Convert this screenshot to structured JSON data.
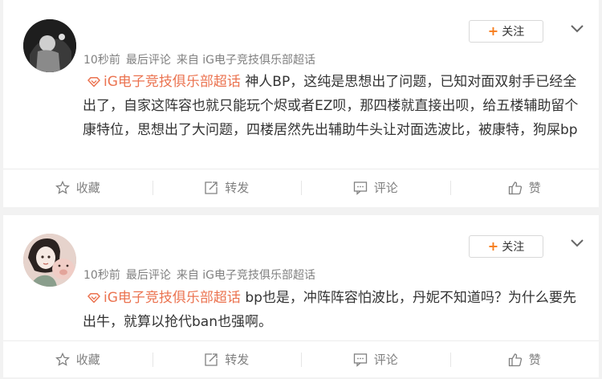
{
  "cards": [
    {
      "meta": {
        "time": "10秒前",
        "tag": "最后评论",
        "source": "来自 iG电子竞技俱乐部超话"
      },
      "follow_label": "关注",
      "topic": "iG电子竞技俱乐部超话",
      "body": "神人BP，这纯是思想出了问题，已知对面双射手已经全出了，自家这阵容也就只能玩个烬或者EZ呗，那四楼就直接出呗，给五楼辅助留个康特位，思想出了大问题，四楼居然先出辅助牛头让对面选波比，被康特，狗屎bp",
      "actions": {
        "fav": "收藏",
        "repost": "转发",
        "comment": "评论",
        "like": "赞"
      }
    },
    {
      "meta": {
        "time": "10秒前",
        "tag": "最后评论",
        "source": "来自 iG电子竞技俱乐部超话"
      },
      "follow_label": "关注",
      "topic": "iG电子竞技俱乐部超话",
      "body": "bp也是，冲阵阵容怕波比，丹妮不知道吗？为什么要先出牛，就算以抢代ban也强啊。",
      "actions": {
        "fav": "收藏",
        "repost": "转发",
        "comment": "评论",
        "like": "赞"
      }
    }
  ],
  "colors": {
    "topic": "#eb7350",
    "follow_plus": "#f77c1b",
    "meta": "#808080"
  },
  "icons": [
    "diamond-icon",
    "star-icon",
    "repost-icon",
    "comment-icon",
    "thumbs-up-icon",
    "chevron-down-icon",
    "plus-icon"
  ]
}
